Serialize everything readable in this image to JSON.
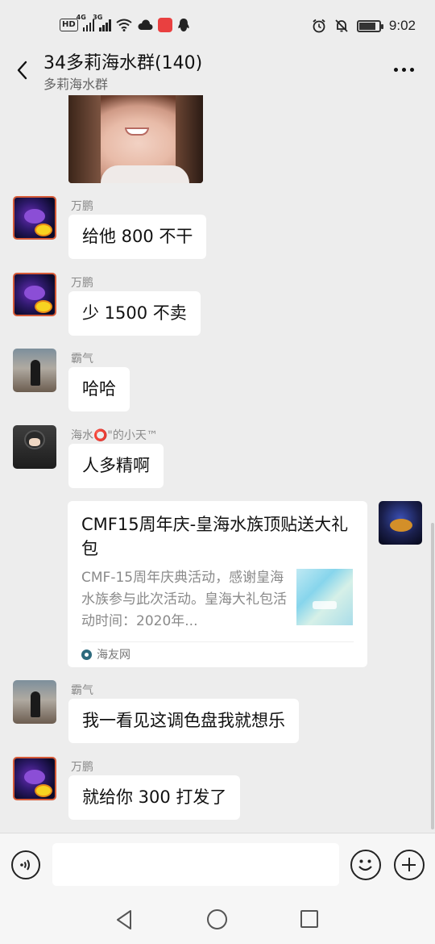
{
  "status_bar": {
    "hd_label": "HD",
    "signal_1_label": "4G",
    "signal_2_label": "3G",
    "time": "9:02"
  },
  "header": {
    "title": "34多莉海水群(140)",
    "subtitle": "多莉海水群"
  },
  "messages": [
    {
      "sender": "万鹏",
      "text": "给他 800 不干"
    },
    {
      "sender": "万鹏",
      "text": "少 1500 不卖"
    },
    {
      "sender": "霸气",
      "text": "哈哈"
    },
    {
      "sender": "海水⭕\"的小天™",
      "text": "人多精啊"
    },
    {
      "sender": "霸气",
      "text": "我一看见这调色盘我就想乐"
    },
    {
      "sender": "万鹏",
      "text": "就给你 300 打发了"
    }
  ],
  "link_card": {
    "title": "CMF15周年庆-皇海水族顶贴送大礼包",
    "description": "CMF-15周年庆典活动，感谢皇海水族参与此次活动。皇海大礼包活动时间：2020年...",
    "source": "海友网"
  },
  "input": {
    "value": "",
    "placeholder": ""
  },
  "icons": {
    "back": "chevron-left-icon",
    "more": "more-dots-icon",
    "voice": "voice-icon",
    "emoji": "emoji-icon",
    "plus": "plus-icon"
  }
}
